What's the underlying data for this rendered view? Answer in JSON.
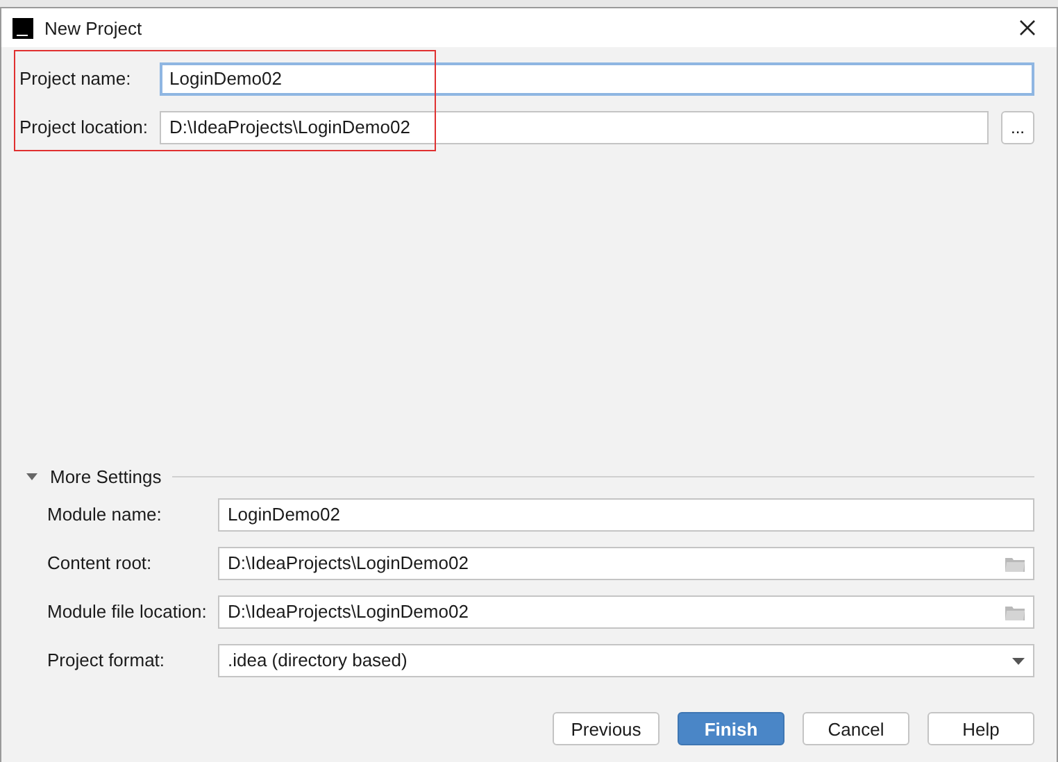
{
  "window": {
    "title": "New Project"
  },
  "project_fields": [
    {
      "label": "Project name:",
      "value": "LoginDemo02",
      "focused": true,
      "browse": false
    },
    {
      "label": "Project location:",
      "value": "D:\\IdeaProjects\\LoginDemo02",
      "focused": false,
      "browse": true,
      "browse_label": "..."
    }
  ],
  "more_settings": {
    "title": "More Settings",
    "expanded": true,
    "fields": [
      {
        "kind": "text",
        "label": "Module name:",
        "value": "LoginDemo02"
      },
      {
        "kind": "folder",
        "label": "Content root:",
        "value": "D:\\IdeaProjects\\LoginDemo02"
      },
      {
        "kind": "folder",
        "label": "Module file location:",
        "value": "D:\\IdeaProjects\\LoginDemo02"
      },
      {
        "kind": "dropdown",
        "label": "Project format:",
        "value": ".idea (directory based)"
      }
    ]
  },
  "buttons": [
    {
      "label": "Previous",
      "kind": "normal"
    },
    {
      "label": "Finish",
      "kind": "default"
    },
    {
      "label": "Cancel",
      "kind": "normal"
    },
    {
      "label": "Help",
      "kind": "normal"
    }
  ]
}
